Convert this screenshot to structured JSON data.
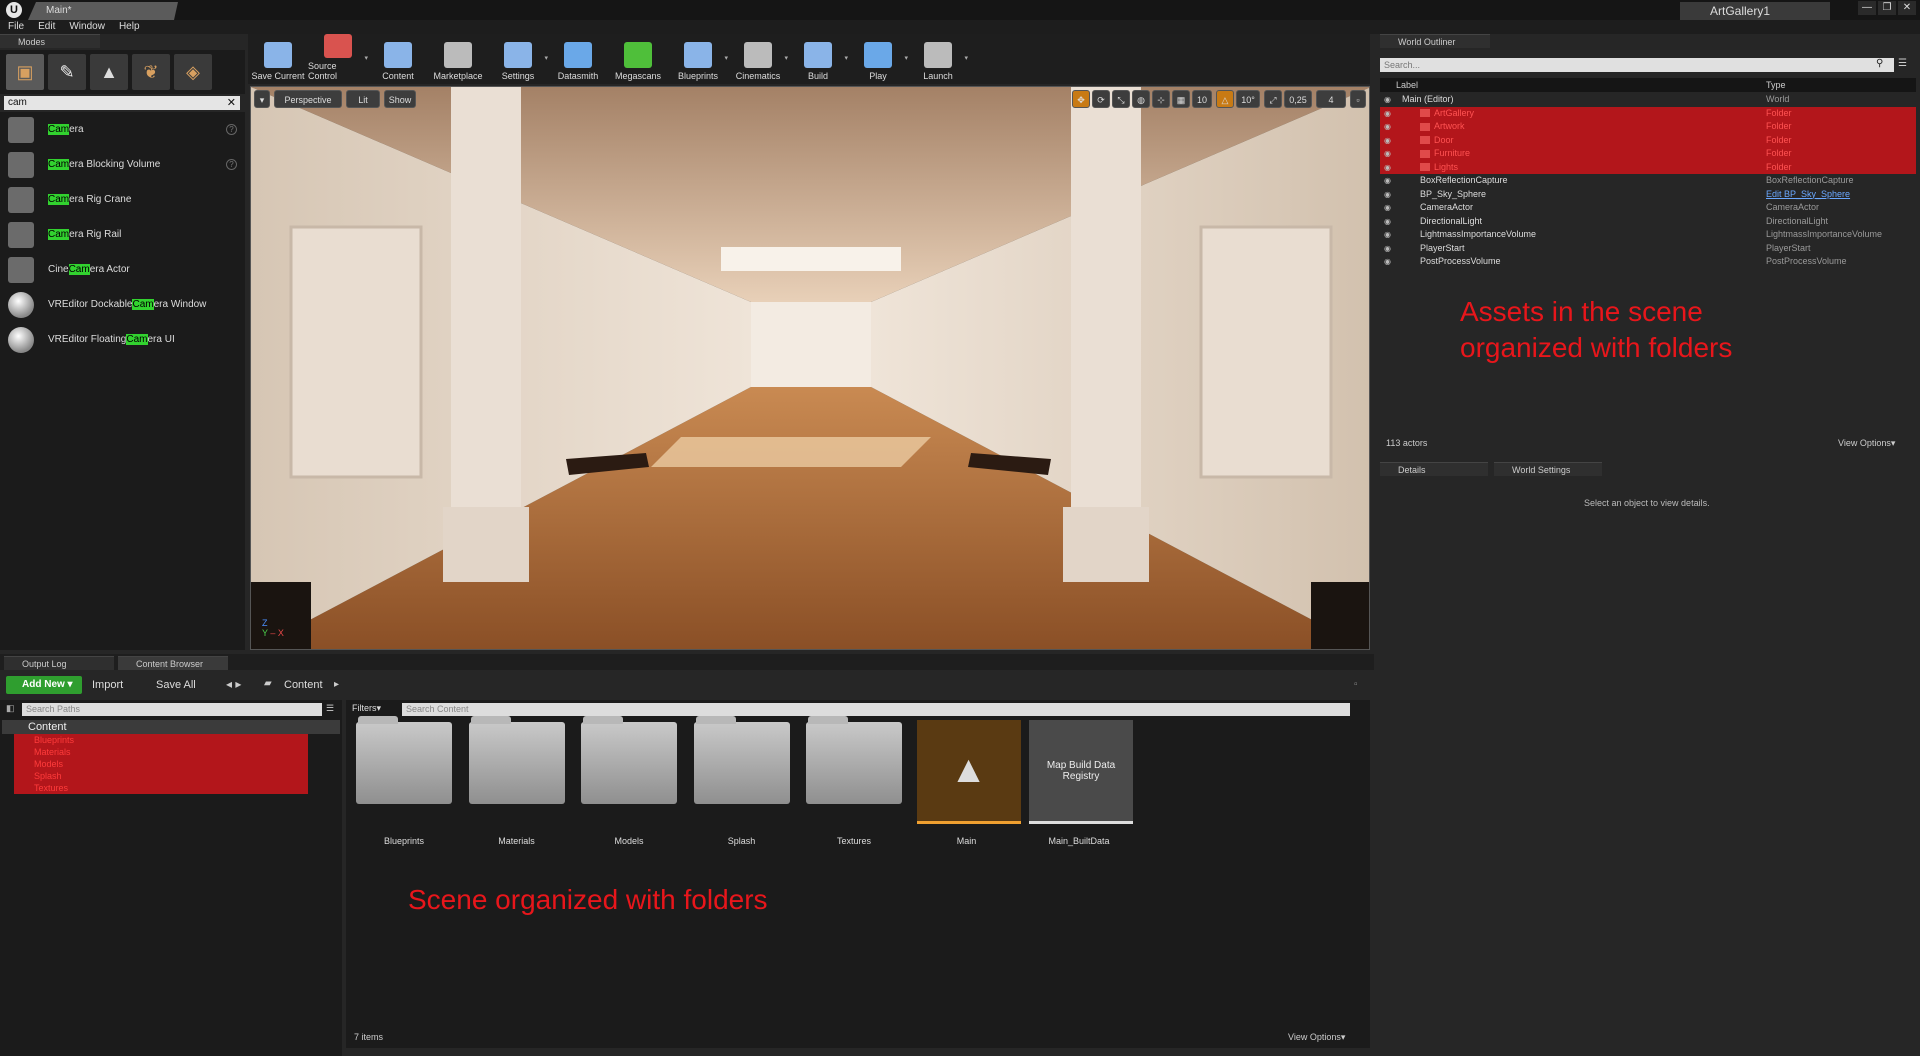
{
  "window": {
    "doc_tab": "Main*",
    "project": "ArtGallery1",
    "buttons": [
      "—",
      "❐",
      "✕"
    ]
  },
  "menu": [
    "File",
    "Edit",
    "Window",
    "Help"
  ],
  "modes": {
    "tab": "Modes",
    "search_value": "cam",
    "search_highlight": "Cam",
    "items": [
      {
        "pre": "",
        "match": "Cam",
        "post": "era"
      },
      {
        "pre": "",
        "match": "Cam",
        "post": "era Blocking Volume"
      },
      {
        "pre": "",
        "match": "Cam",
        "post": "era Rig Crane"
      },
      {
        "pre": "",
        "match": "Cam",
        "post": "era Rig Rail"
      },
      {
        "pre": "Cine ",
        "match": "Cam",
        "post": "era Actor"
      },
      {
        "pre": "VREditor Dockable ",
        "match": "Cam",
        "post": "era Window"
      },
      {
        "pre": "VREditor Floating ",
        "match": "Cam",
        "post": "era UI"
      }
    ]
  },
  "toolbar": [
    {
      "label": "Save Current",
      "color": "#8ab4e8"
    },
    {
      "label": "Source Control",
      "color": "#d9534f"
    },
    {
      "label": "Content",
      "color": "#8ab4e8"
    },
    {
      "label": "Marketplace",
      "color": "#bbbbbb"
    },
    {
      "label": "Settings",
      "color": "#8ab4e8"
    },
    {
      "label": "Datasmith",
      "color": "#6aa8e8"
    },
    {
      "label": "Megascans",
      "color": "#4fbf3a"
    },
    {
      "label": "Blueprints",
      "color": "#8ab4e8"
    },
    {
      "label": "Cinematics",
      "color": "#bbbbbb"
    },
    {
      "label": "Build",
      "color": "#8ab4e8"
    },
    {
      "label": "Play",
      "color": "#6aa8e8"
    },
    {
      "label": "Launch",
      "color": "#bbbbbb"
    }
  ],
  "viewport": {
    "perspective": "Perspective",
    "lit": "Lit",
    "show": "Show",
    "grid": "10",
    "rotate": "10°",
    "scale": "0,25",
    "speed": "4"
  },
  "outliner": {
    "tab": "World Outliner",
    "search_placeholder": "Search...",
    "col_label": "Label",
    "col_type": "Type",
    "rows": [
      {
        "label": "Main (Editor)",
        "type": "World",
        "folder": false,
        "indent": 0
      },
      {
        "label": "ArtGallery",
        "type": "Folder",
        "folder": true,
        "indent": 1
      },
      {
        "label": "Artwork",
        "type": "Folder",
        "folder": true,
        "indent": 1
      },
      {
        "label": "Door",
        "type": "Folder",
        "folder": true,
        "indent": 1
      },
      {
        "label": "Furniture",
        "type": "Folder",
        "folder": true,
        "indent": 1
      },
      {
        "label": "Lights",
        "type": "Folder",
        "folder": true,
        "indent": 1
      },
      {
        "label": "BoxReflectionCapture",
        "type": "BoxReflectionCapture",
        "folder": false,
        "indent": 1
      },
      {
        "label": "BP_Sky_Sphere",
        "type": "Edit BP_Sky_Sphere",
        "folder": false,
        "indent": 1
      },
      {
        "label": "CameraActor",
        "type": "CameraActor",
        "folder": false,
        "indent": 1
      },
      {
        "label": "DirectionalLight",
        "type": "DirectionalLight",
        "folder": false,
        "indent": 1
      },
      {
        "label": "LightmassImportanceVolume",
        "type": "LightmassImportanceVolume",
        "folder": false,
        "indent": 1
      },
      {
        "label": "PlayerStart",
        "type": "PlayerStart",
        "folder": false,
        "indent": 1
      },
      {
        "label": "PostProcessVolume",
        "type": "PostProcessVolume",
        "folder": false,
        "indent": 1
      }
    ],
    "annotation_line1": "Assets in the scene",
    "annotation_line2": "organized with folders",
    "actor_count": "113 actors",
    "view_options": "View Options▾"
  },
  "details": {
    "tab_details": "Details",
    "tab_world": "World Settings",
    "empty_msg": "Select an object to view details."
  },
  "content_browser": {
    "tab_output": "Output Log",
    "tab_cb": "Content Browser",
    "add_new": "Add New ▾",
    "import": "Import",
    "save_all": "Save All",
    "path": "Content",
    "search_paths": "Search Paths",
    "filters": "Filters▾",
    "search_content": "Search Content",
    "tree_root": "Content",
    "tree": [
      "Blueprints",
      "Materials",
      "Models",
      "Splash",
      "Textures"
    ],
    "assets": [
      {
        "label": "Blueprints",
        "kind": "folder"
      },
      {
        "label": "Materials",
        "kind": "folder"
      },
      {
        "label": "Models",
        "kind": "folder"
      },
      {
        "label": "Splash",
        "kind": "folder"
      },
      {
        "label": "Textures",
        "kind": "folder"
      },
      {
        "label": "Main",
        "kind": "map"
      },
      {
        "label": "Main_BuiltData",
        "kind": "data",
        "thumb_text": "Map Build Data Registry"
      }
    ],
    "annotation": "Scene organized with folders",
    "item_count": "7 items",
    "view_options": "View Options▾"
  }
}
